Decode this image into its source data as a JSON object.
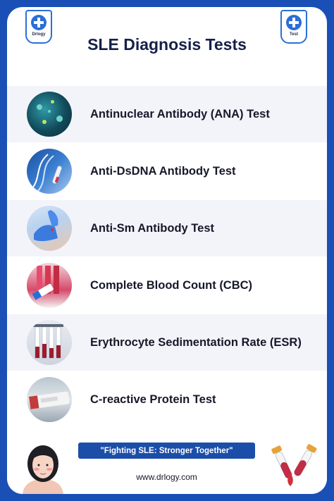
{
  "header": {
    "title": "SLE Diagnosis Tests",
    "left_badge_text": "Drlogy",
    "right_badge_text": "Test"
  },
  "tests": [
    {
      "label": "Antinuclear Antibody (ANA) Test",
      "icon": "ana-cells-icon"
    },
    {
      "label": "Anti-DsDNA Antibody Test",
      "icon": "dna-helix-icon"
    },
    {
      "label": "Anti-Sm Antibody Test",
      "icon": "gloved-hands-icon"
    },
    {
      "label": "Complete Blood Count (CBC)",
      "icon": "blood-tubes-icon"
    },
    {
      "label": "Erythrocyte Sedimentation Rate (ESR)",
      "icon": "esr-tubes-icon"
    },
    {
      "label": "C-reactive Protein Test",
      "icon": "crp-tube-icon"
    }
  ],
  "footer": {
    "quote": "\"Fighting SLE: Stronger Together\"",
    "website": "www.drlogy.com"
  },
  "colors": {
    "frame": "#1a4fb5",
    "accent": "#1b4ea8",
    "row_shade": "#f3f4fa",
    "title_text": "#16214a"
  }
}
